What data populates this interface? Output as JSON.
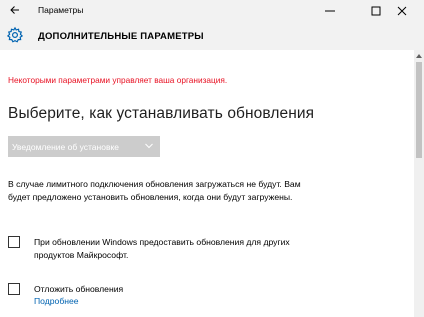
{
  "window": {
    "title": "Параметры"
  },
  "header": {
    "title": "ДОПОЛНИТЕЛЬНЫЕ ПАРАМЕТРЫ"
  },
  "main": {
    "warning": "Некоторыми параметрами управляет ваша организация.",
    "heading": "Выберите, как устанавливать обновления",
    "dropdown_value": "Уведомление об установке",
    "paragraph": "В случае лимитного подключения обновления загружаться не будут. Вам будет предложено установить обновления, когда они будут загружены.",
    "checkbox_other_products": {
      "label": "При обновлении Windows предоставить обновления для других продуктов Майкрософт.",
      "checked": false
    },
    "checkbox_defer": {
      "label": "Отложить обновления",
      "checked": false
    },
    "link_more": "Подробнее"
  },
  "colors": {
    "warning": "#e81123",
    "link": "#0063b1",
    "chrome_bg": "#f2f2f2",
    "dropdown_disabled": "#cccccc"
  },
  "icons": [
    "back-arrow-icon",
    "gear-icon",
    "minimize-icon",
    "maximize-icon",
    "close-icon",
    "chevron-down-icon",
    "scroll-up-arrow-icon"
  ]
}
